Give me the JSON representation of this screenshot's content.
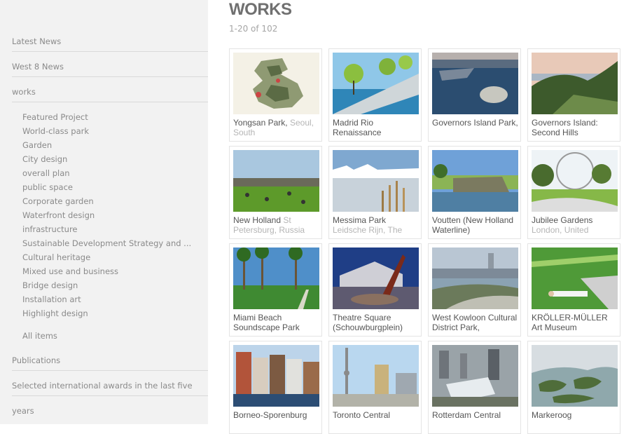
{
  "sidebar": {
    "top_items": [
      "Latest News",
      "West 8 News",
      "works"
    ],
    "categories": [
      "Featured Project",
      "World-class park",
      "Garden",
      "City design",
      "overall plan",
      "public space",
      "Corporate garden",
      "Waterfront design",
      "infrastructure",
      "Sustainable Development Strategy and ...",
      "Cultural heritage",
      "Mixed use and business",
      "Bridge design",
      "Installation art",
      "Highlight design"
    ],
    "all_items": "All items",
    "bottom_items": [
      "Publications",
      "Selected international awards in the last five",
      "years"
    ]
  },
  "main": {
    "title": "WORKS",
    "count": "1-20 of 102",
    "works": [
      {
        "name": "Yongsan Park,",
        "location": "Seoul, South",
        "thumb": "plan"
      },
      {
        "name": "Madrid Rio Renaissance",
        "location": "",
        "thumb": "trees-water"
      },
      {
        "name": "Governors Island Park,",
        "location": "",
        "thumb": "aerial-water"
      },
      {
        "name": "Governors Island: Second Hills",
        "location": "",
        "thumb": "hill-sunset"
      },
      {
        "name": "New Holland",
        "location": "St Petersburg, Russia",
        "thumb": "lawn-crowd"
      },
      {
        "name": "Messima Park",
        "location": "Leidsche Rijn, The",
        "thumb": "winter-reeds"
      },
      {
        "name": "Voutten (New Holland Waterline)",
        "location": "",
        "thumb": "fort"
      },
      {
        "name": "Jubilee Gardens",
        "location": "London, United",
        "thumb": "eye-park"
      },
      {
        "name": "Miami Beach Soundscape Park",
        "location": "",
        "thumb": "palms"
      },
      {
        "name": "Theatre Square (Schouwburgplein)",
        "location": "",
        "thumb": "plaza-dusk"
      },
      {
        "name": "West Kowloon Cultural District Park,",
        "location": "",
        "thumb": "harbour"
      },
      {
        "name": "KRÖLLER-MÜLLER Art Museum",
        "location": "",
        "thumb": "green-lounge"
      },
      {
        "name": "Borneo-Sporenburg",
        "location": "",
        "thumb": "canal-houses"
      },
      {
        "name": "Toronto Central",
        "location": "",
        "thumb": "tower"
      },
      {
        "name": "Rotterdam Central",
        "location": "",
        "thumb": "city-aerial"
      },
      {
        "name": "Markeroog",
        "location": "",
        "thumb": "islands"
      }
    ]
  }
}
